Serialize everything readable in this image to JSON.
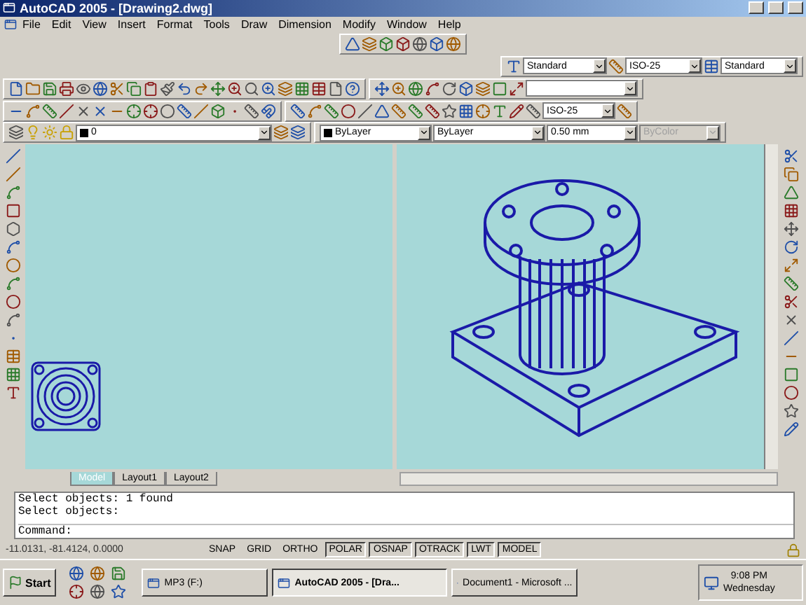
{
  "window": {
    "title": "AutoCAD 2005 - [Drawing2.dwg]"
  },
  "menu": [
    "File",
    "Edit",
    "View",
    "Insert",
    "Format",
    "Tools",
    "Draw",
    "Dimension",
    "Modify",
    "Window",
    "Help"
  ],
  "styles_toolbar": {
    "text_style": "Standard",
    "dim_style": "ISO-25",
    "table_style": "Standard"
  },
  "dimension_toolbar": {
    "dim_style": "ISO-25"
  },
  "properties_toolbar": {
    "layer": "0",
    "color_control": "ByLayer",
    "linetype": "ByLayer",
    "lineweight": "0.50 mm",
    "plot_style": "ByColor",
    "plot_style_disabled": true
  },
  "layout_tabs": [
    {
      "label": "Model",
      "selected": true
    },
    {
      "label": "Layout1",
      "selected": false
    },
    {
      "label": "Layout2",
      "selected": false
    }
  ],
  "command_history": [
    "Select objects: 1 found",
    "Select objects:"
  ],
  "command_prompt": "Command:",
  "status_bar": {
    "coordinates": "-11.0131, -81.4124, 0.0000",
    "toggles": [
      {
        "label": "SNAP",
        "on": false
      },
      {
        "label": "GRID",
        "on": false
      },
      {
        "label": "ORTHO",
        "on": false
      },
      {
        "label": "POLAR",
        "on": true
      },
      {
        "label": "OSNAP",
        "on": true
      },
      {
        "label": "OTRACK",
        "on": true
      },
      {
        "label": "LWT",
        "on": true
      },
      {
        "label": "MODEL",
        "on": true
      }
    ]
  },
  "taskbar": {
    "start": "Start",
    "tasks": [
      {
        "label": "MP3 (F:)",
        "selected": false
      },
      {
        "label": "AutoCAD 2005 - [Dra...",
        "selected": true
      },
      {
        "label": "Document1 - Microsoft ...",
        "selected": false
      }
    ],
    "time": "9:08 PM",
    "day": "Wednesday"
  }
}
